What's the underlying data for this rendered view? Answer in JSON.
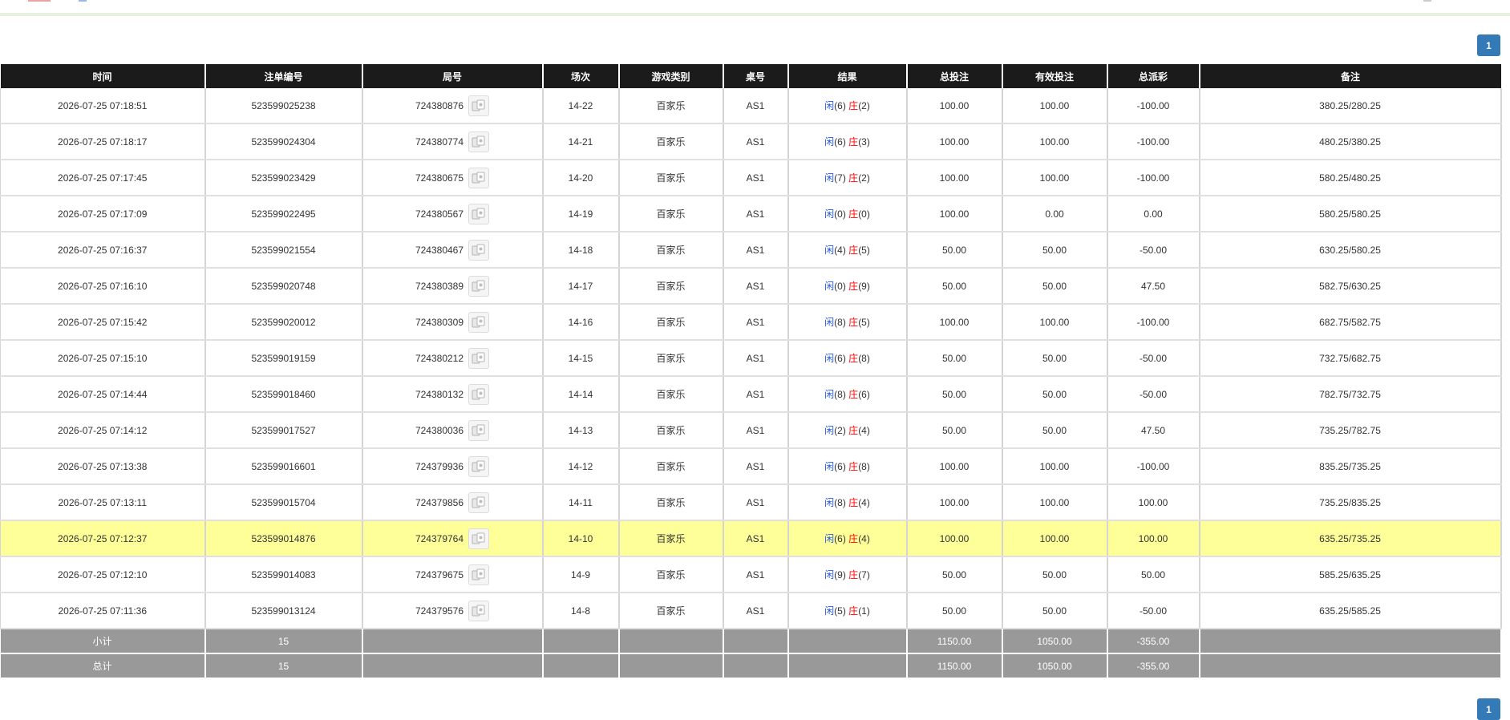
{
  "pagination": {
    "current_page": "1"
  },
  "columns": [
    "时间",
    "注单编号",
    "局号",
    "场次",
    "游戏类别",
    "桌号",
    "结果",
    "总投注",
    "有效投注",
    "总派彩",
    "备注"
  ],
  "rows": [
    {
      "time": "2026-07-25 07:18:51",
      "bet_id": "523599025238",
      "round": "724380876",
      "shoe": "14-22",
      "game": "百家乐",
      "table": "AS1",
      "player_label": "闲",
      "player_points": "(6)",
      "banker_label": "庄",
      "banker_points": "(2)",
      "total_bet": "100.00",
      "valid_bet": "100.00",
      "payout": "-100.00",
      "payout_color": "red",
      "note": "380.25/280.25",
      "highlight": false
    },
    {
      "time": "2026-07-25 07:18:17",
      "bet_id": "523599024304",
      "round": "724380774",
      "shoe": "14-21",
      "game": "百家乐",
      "table": "AS1",
      "player_label": "闲",
      "player_points": "(6)",
      "banker_label": "庄",
      "banker_points": "(3)",
      "total_bet": "100.00",
      "valid_bet": "100.00",
      "payout": "-100.00",
      "payout_color": "red",
      "note": "480.25/380.25",
      "highlight": false
    },
    {
      "time": "2026-07-25 07:17:45",
      "bet_id": "523599023429",
      "round": "724380675",
      "shoe": "14-20",
      "game": "百家乐",
      "table": "AS1",
      "player_label": "闲",
      "player_points": "(7)",
      "banker_label": "庄",
      "banker_points": "(2)",
      "total_bet": "100.00",
      "valid_bet": "100.00",
      "payout": "-100.00",
      "payout_color": "red",
      "note": "580.25/480.25",
      "highlight": false
    },
    {
      "time": "2026-07-25 07:17:09",
      "bet_id": "523599022495",
      "round": "724380567",
      "shoe": "14-19",
      "game": "百家乐",
      "table": "AS1",
      "player_label": "闲",
      "player_points": "(0)",
      "banker_label": "庄",
      "banker_points": "(0)",
      "total_bet": "100.00",
      "valid_bet": "0.00",
      "payout": "0.00",
      "payout_color": "black",
      "note": "580.25/580.25",
      "highlight": false
    },
    {
      "time": "2026-07-25 07:16:37",
      "bet_id": "523599021554",
      "round": "724380467",
      "shoe": "14-18",
      "game": "百家乐",
      "table": "AS1",
      "player_label": "闲",
      "player_points": "(4)",
      "banker_label": "庄",
      "banker_points": "(5)",
      "total_bet": "50.00",
      "valid_bet": "50.00",
      "payout": "-50.00",
      "payout_color": "red",
      "note": "630.25/580.25",
      "highlight": false
    },
    {
      "time": "2026-07-25 07:16:10",
      "bet_id": "523599020748",
      "round": "724380389",
      "shoe": "14-17",
      "game": "百家乐",
      "table": "AS1",
      "player_label": "闲",
      "player_points": "(0)",
      "banker_label": "庄",
      "banker_points": "(9)",
      "total_bet": "50.00",
      "valid_bet": "50.00",
      "payout": "47.50",
      "payout_color": "black",
      "note": "582.75/630.25",
      "highlight": false
    },
    {
      "time": "2026-07-25 07:15:42",
      "bet_id": "523599020012",
      "round": "724380309",
      "shoe": "14-16",
      "game": "百家乐",
      "table": "AS1",
      "player_label": "闲",
      "player_points": "(8)",
      "banker_label": "庄",
      "banker_points": "(5)",
      "total_bet": "100.00",
      "valid_bet": "100.00",
      "payout": "-100.00",
      "payout_color": "red",
      "note": "682.75/582.75",
      "highlight": false
    },
    {
      "time": "2026-07-25 07:15:10",
      "bet_id": "523599019159",
      "round": "724380212",
      "shoe": "14-15",
      "game": "百家乐",
      "table": "AS1",
      "player_label": "闲",
      "player_points": "(6)",
      "banker_label": "庄",
      "banker_points": "(8)",
      "total_bet": "50.00",
      "valid_bet": "50.00",
      "payout": "-50.00",
      "payout_color": "red",
      "note": "732.75/682.75",
      "highlight": false
    },
    {
      "time": "2026-07-25 07:14:44",
      "bet_id": "523599018460",
      "round": "724380132",
      "shoe": "14-14",
      "game": "百家乐",
      "table": "AS1",
      "player_label": "闲",
      "player_points": "(8)",
      "banker_label": "庄",
      "banker_points": "(6)",
      "total_bet": "50.00",
      "valid_bet": "50.00",
      "payout": "-50.00",
      "payout_color": "red",
      "note": "782.75/732.75",
      "highlight": false
    },
    {
      "time": "2026-07-25 07:14:12",
      "bet_id": "523599017527",
      "round": "724380036",
      "shoe": "14-13",
      "game": "百家乐",
      "table": "AS1",
      "player_label": "闲",
      "player_points": "(2)",
      "banker_label": "庄",
      "banker_points": "(4)",
      "total_bet": "50.00",
      "valid_bet": "50.00",
      "payout": "47.50",
      "payout_color": "black",
      "note": "735.25/782.75",
      "highlight": false
    },
    {
      "time": "2026-07-25 07:13:38",
      "bet_id": "523599016601",
      "round": "724379936",
      "shoe": "14-12",
      "game": "百家乐",
      "table": "AS1",
      "player_label": "闲",
      "player_points": "(6)",
      "banker_label": "庄",
      "banker_points": "(8)",
      "total_bet": "100.00",
      "valid_bet": "100.00",
      "payout": "-100.00",
      "payout_color": "red",
      "note": "835.25/735.25",
      "highlight": false
    },
    {
      "time": "2026-07-25 07:13:11",
      "bet_id": "523599015704",
      "round": "724379856",
      "shoe": "14-11",
      "game": "百家乐",
      "table": "AS1",
      "player_label": "闲",
      "player_points": "(8)",
      "banker_label": "庄",
      "banker_points": "(4)",
      "total_bet": "100.00",
      "valid_bet": "100.00",
      "payout": "100.00",
      "payout_color": "black",
      "note": "735.25/835.25",
      "highlight": false
    },
    {
      "time": "2026-07-25 07:12:37",
      "bet_id": "523599014876",
      "round": "724379764",
      "shoe": "14-10",
      "game": "百家乐",
      "table": "AS1",
      "player_label": "闲",
      "player_points": "(6)",
      "banker_label": "庄",
      "banker_points": "(4)",
      "total_bet": "100.00",
      "valid_bet": "100.00",
      "payout": "100.00",
      "payout_color": "black",
      "note": "635.25/735.25",
      "highlight": true
    },
    {
      "time": "2026-07-25 07:12:10",
      "bet_id": "523599014083",
      "round": "724379675",
      "shoe": "14-9",
      "game": "百家乐",
      "table": "AS1",
      "player_label": "闲",
      "player_points": "(9)",
      "banker_label": "庄",
      "banker_points": "(7)",
      "total_bet": "50.00",
      "valid_bet": "50.00",
      "payout": "50.00",
      "payout_color": "black",
      "note": "585.25/635.25",
      "highlight": false
    },
    {
      "time": "2026-07-25 07:11:36",
      "bet_id": "523599013124",
      "round": "724379576",
      "shoe": "14-8",
      "game": "百家乐",
      "table": "AS1",
      "player_label": "闲",
      "player_points": "(5)",
      "banker_label": "庄",
      "banker_points": "(1)",
      "total_bet": "50.00",
      "valid_bet": "50.00",
      "payout": "-50.00",
      "payout_color": "red",
      "note": "635.25/585.25",
      "highlight": false
    }
  ],
  "subtotal": {
    "label": "小计",
    "count": "15",
    "total_bet": "1150.00",
    "valid_bet": "1050.00",
    "payout": "-355.00"
  },
  "total": {
    "label": "总计",
    "count": "15",
    "total_bet": "1150.00",
    "valid_bet": "1050.00",
    "payout": "-355.00"
  },
  "icons": {
    "round_detail": "card-view-icon"
  },
  "colors": {
    "header_bg": "#1b1b1b",
    "summary_bg": "#999999",
    "highlight_row": "#ffff99",
    "accent_blue": "#2457e8",
    "negative_red": "#ff0000",
    "page_button": "#337ab7"
  }
}
